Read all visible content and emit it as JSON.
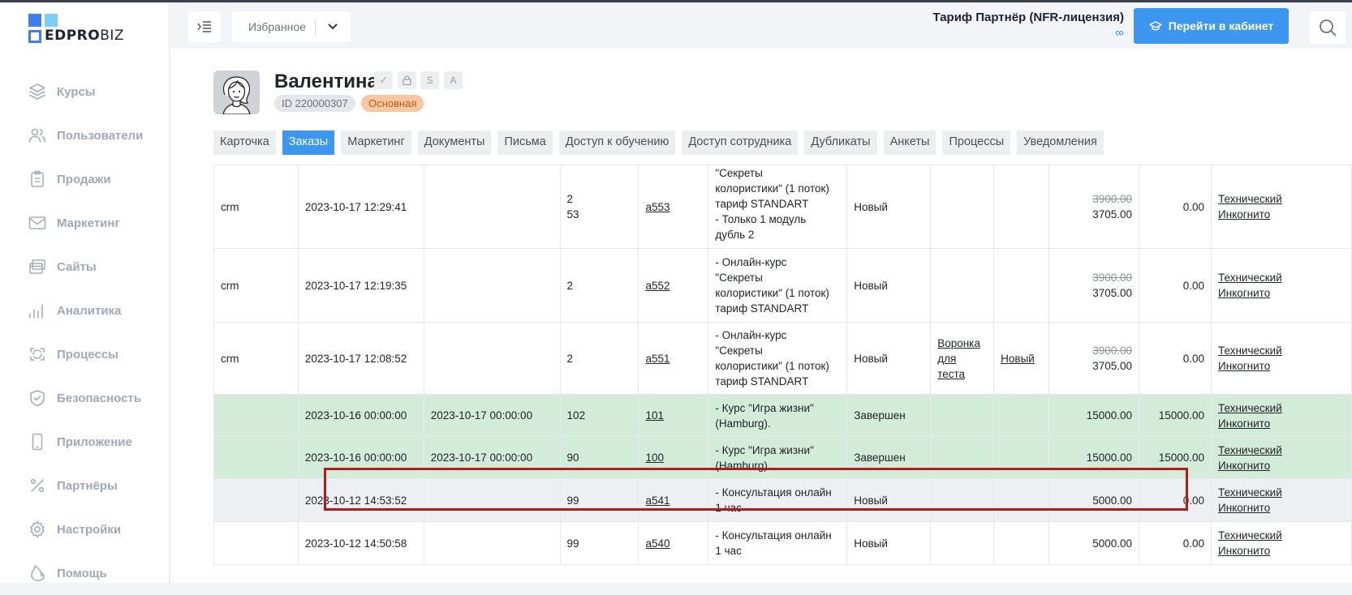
{
  "brand": {
    "name_bold": "EDPRO",
    "name_light": "BIZ",
    "colors": {
      "primary": "#3d7ff0",
      "secondary": "#79cff5"
    }
  },
  "sidebar": {
    "items": [
      {
        "label": "Курсы",
        "icon": "layers-icon"
      },
      {
        "label": "Пользователи",
        "icon": "users-icon"
      },
      {
        "label": "Продажи",
        "icon": "clipboard-icon"
      },
      {
        "label": "Маркетинг",
        "icon": "mail-icon"
      },
      {
        "label": "Сайты",
        "icon": "windows-icon"
      },
      {
        "label": "Аналитика",
        "icon": "bar-chart-icon"
      },
      {
        "label": "Процессы",
        "icon": "process-icon"
      },
      {
        "label": "Безопасность",
        "icon": "shield-icon"
      },
      {
        "label": "Приложение",
        "icon": "phone-icon"
      },
      {
        "label": "Партнёры",
        "icon": "percent-icon"
      },
      {
        "label": "Настройки",
        "icon": "gear-icon"
      },
      {
        "label": "Помощь",
        "icon": "flame-icon"
      }
    ]
  },
  "header": {
    "favorites_label": "Избранное",
    "tariff_title": "Тариф Партнёр (NFR-лицензия)",
    "tariff_term": "∞",
    "cabinet_button": "Перейти в кабинет",
    "accent": "#3d97f0"
  },
  "user": {
    "name": "Валентина",
    "marks": [
      "✓",
      "🔒",
      "S",
      "A"
    ],
    "id_label": "ID 220000307",
    "role_badge": "Основная"
  },
  "tabs": [
    {
      "label": "Карточка",
      "active": false
    },
    {
      "label": "Заказы",
      "active": true
    },
    {
      "label": "Маркетинг",
      "active": false
    },
    {
      "label": "Документы",
      "active": false
    },
    {
      "label": "Письма",
      "active": false
    },
    {
      "label": "Доступ к обучению",
      "active": false
    },
    {
      "label": "Доступ сотрудника",
      "active": false
    },
    {
      "label": "Дубликаты",
      "active": false
    },
    {
      "label": "Анкеты",
      "active": false
    },
    {
      "label": "Процессы",
      "active": false
    },
    {
      "label": "Уведомления",
      "active": false
    }
  ],
  "orders": [
    {
      "src": "crm",
      "created": "2023-10-17 12:29:41",
      "paid": "",
      "pos": [
        "2",
        "53"
      ],
      "num": "a553",
      "product": [
        "\"Секреты",
        "колористики\" (1 поток)",
        "тариф STANDART",
        "- Только 1 модуль",
        "дубль 2"
      ],
      "status": "Новый",
      "funnel": [],
      "stage": "",
      "price_old": "3900.00",
      "price": "3705.00",
      "paid_sum": "0.00",
      "manager": [
        "Технический",
        "Инкогнито"
      ],
      "style": "white"
    },
    {
      "src": "crm",
      "created": "2023-10-17 12:19:35",
      "paid": "",
      "pos": [
        "2"
      ],
      "num": "a552",
      "product": [
        "- Онлайн-курс",
        "\"Секреты",
        "колористики\" (1 поток)",
        "тариф STANDART"
      ],
      "status": "Новый",
      "funnel": [],
      "stage": "",
      "price_old": "3900.00",
      "price": "3705.00",
      "paid_sum": "0.00",
      "manager": [
        "Технический",
        "Инкогнито"
      ],
      "style": "white"
    },
    {
      "src": "crm",
      "created": "2023-10-17 12:08:52",
      "paid": "",
      "pos": [
        "2"
      ],
      "num": "a551",
      "product": [
        "- Онлайн-курс",
        "\"Секреты",
        "колористики\" (1 поток)",
        "тариф STANDART"
      ],
      "status": "Новый",
      "funnel": [
        "Воронка",
        "для",
        "теста"
      ],
      "stage": "Новый",
      "price_old": "3900.00",
      "price": "3705.00",
      "paid_sum": "0.00",
      "manager": [
        "Технический",
        "Инкогнито"
      ],
      "style": "white"
    },
    {
      "src": "",
      "created": "2023-10-16 00:00:00",
      "paid": "2023-10-17 00:00:00",
      "pos": [
        "102"
      ],
      "num": "101",
      "product": [
        "- Курс \"Игра жизни\"",
        "(Hamburg)."
      ],
      "status": "Завершен",
      "funnel": [],
      "stage": "",
      "price_old": "",
      "price": "15000.00",
      "paid_sum": "15000.00",
      "manager": [
        "Технический",
        "Инкогнито"
      ],
      "style": "green"
    },
    {
      "src": "",
      "created": "2023-10-16 00:00:00",
      "paid": "2023-10-17 00:00:00",
      "pos": [
        "90"
      ],
      "num": "100",
      "product": [
        "- Курс \"Игра жизни\"",
        "(Hamburg)"
      ],
      "status": "Завершен",
      "funnel": [],
      "stage": "",
      "price_old": "",
      "price": "15000.00",
      "paid_sum": "15000.00",
      "manager": [
        "Технический",
        "Инкогнито"
      ],
      "style": "green"
    },
    {
      "src": "",
      "created": "2023-10-12 14:53:52",
      "paid": "",
      "pos": [
        "99"
      ],
      "num": "a541",
      "product": [
        "- Консультация онлайн",
        "1 час"
      ],
      "status": "Новый",
      "funnel": [],
      "stage": "",
      "price_old": "",
      "price": "5000.00",
      "paid_sum": "0.00",
      "manager": [
        "Технический",
        "Инкогнито"
      ],
      "style": "gray"
    },
    {
      "src": "",
      "created": "2023-10-12 14:50:58",
      "paid": "",
      "pos": [
        "99"
      ],
      "num": "a540",
      "product": [
        "- Консультация онлайн",
        "1 час"
      ],
      "status": "Новый",
      "funnel": [],
      "stage": "",
      "price_old": "",
      "price": "5000.00",
      "paid_sum": "0.00",
      "manager": [
        "Технический",
        "Инкогнито"
      ],
      "style": "white"
    }
  ]
}
